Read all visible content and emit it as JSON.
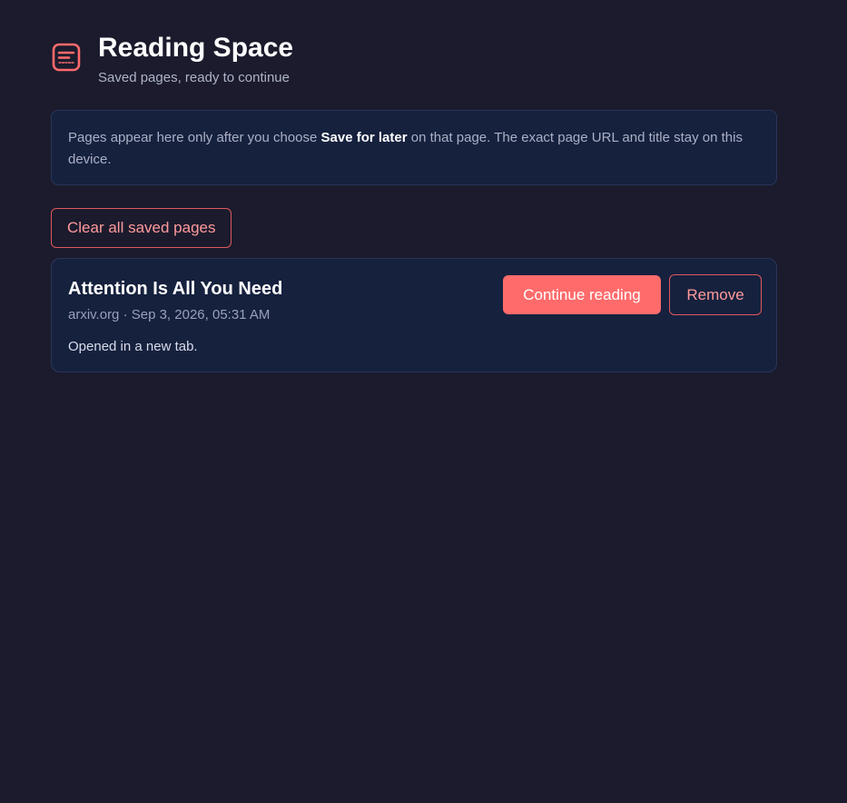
{
  "header": {
    "logo_icon": "document-icon",
    "title": "Reading Space",
    "subtitle": "Saved pages, ready to continue"
  },
  "notice": {
    "text_before": "Pages appear here only after you choose ",
    "emphasis": "Save for later",
    "text_after": " on that page. The exact page URL and title stay on this device."
  },
  "actions": {
    "clear_label": "Clear all saved pages"
  },
  "saved_pages": [
    {
      "title": "Attention Is All You Need",
      "meta": "arxiv.org · Sep 3, 2026, 05:31 AM",
      "status": "Opened in a new tab.",
      "continue_label": "Continue reading",
      "remove_label": "Remove"
    }
  ],
  "colors": {
    "background": "#1b1b2d",
    "card": "#16213e",
    "accent": "#ff6b6b",
    "accent_text": "#ff9a9c"
  }
}
